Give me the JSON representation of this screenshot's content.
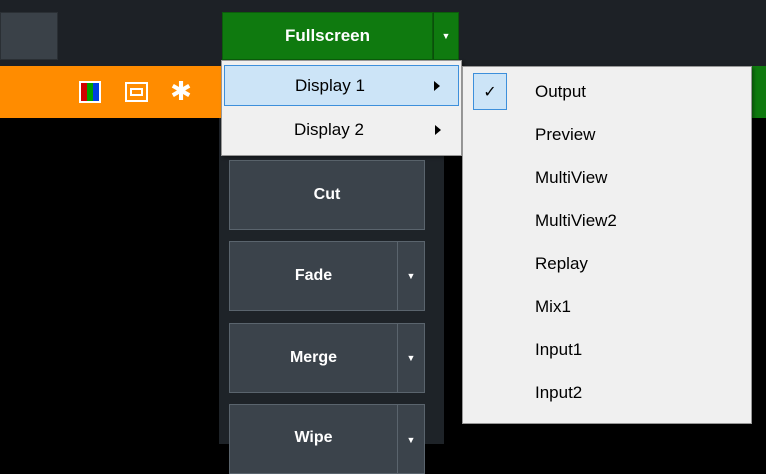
{
  "toolbar": {
    "fullscreen_label": "Fullscreen",
    "caret": "▼"
  },
  "icons": {
    "gear": "✱"
  },
  "transitions": {
    "cut_label": "Cut",
    "fade_label": "Fade",
    "merge_label": "Merge",
    "wipe_label": "Wipe",
    "caret": "▼"
  },
  "fullscreen_menu": {
    "items": [
      {
        "label": "Display 1",
        "selected": true
      },
      {
        "label": "Display 2",
        "selected": false
      }
    ]
  },
  "display_submenu": {
    "check": "✓",
    "items": [
      {
        "label": "Output",
        "checked": true
      },
      {
        "label": "Preview",
        "checked": false
      },
      {
        "label": "MultiView",
        "checked": false
      },
      {
        "label": "MultiView2",
        "checked": false
      },
      {
        "label": "Replay",
        "checked": false
      },
      {
        "label": "Mix1",
        "checked": false
      },
      {
        "label": "Input1",
        "checked": false
      },
      {
        "label": "Input2",
        "checked": false
      }
    ]
  },
  "colors": {
    "fullscreen_green": "#0f7a0f",
    "strip_orange": "#ff8c00",
    "menu_highlight": "#cce4f7",
    "menu_highlight_border": "#3d8fdb"
  }
}
